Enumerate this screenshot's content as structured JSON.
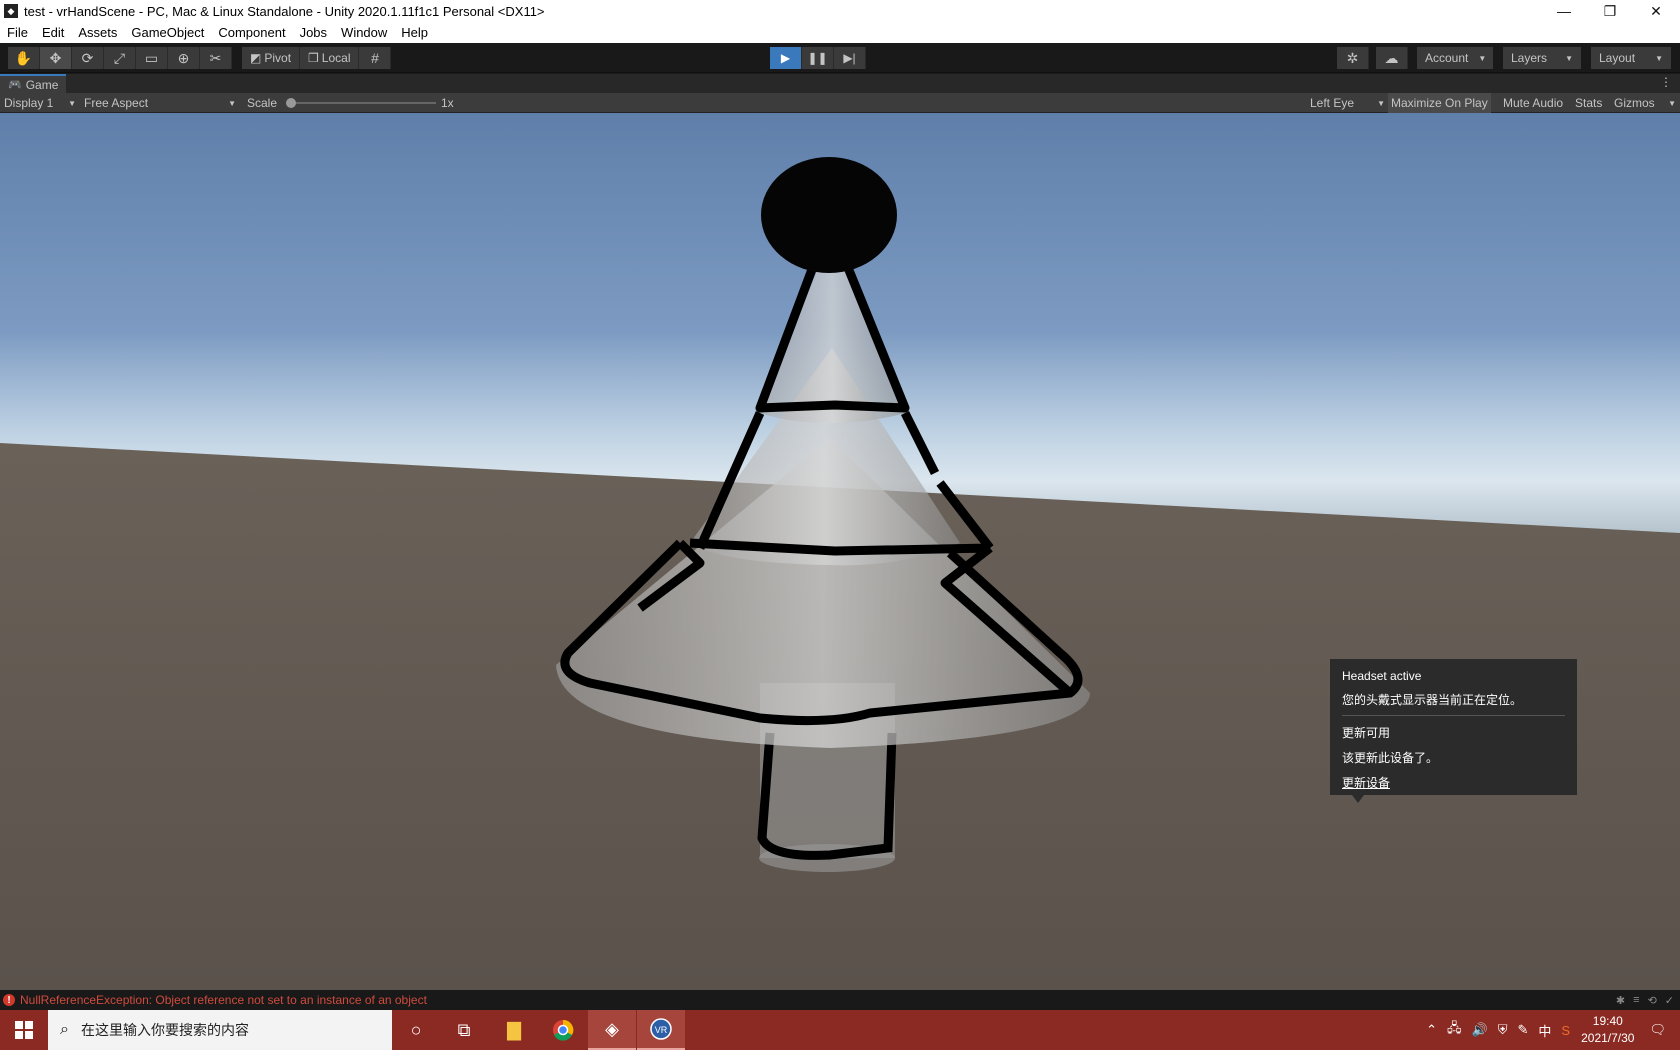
{
  "window": {
    "title": "test - vrHandScene - PC, Mac & Linux Standalone - Unity 2020.1.11f1c1 Personal <DX11>",
    "minimize": "—",
    "restore": "❐",
    "close": "✕"
  },
  "menu": [
    "File",
    "Edit",
    "Assets",
    "GameObject",
    "Component",
    "Jobs",
    "Window",
    "Help"
  ],
  "toolbar": {
    "pivot_label": "Pivot",
    "local_label": "Local",
    "account_label": "Account",
    "layers_label": "Layers",
    "layout_label": "Layout"
  },
  "game_panel": {
    "tab_label": "Game",
    "display_label": "Display 1",
    "aspect_label": "Free Aspect",
    "scale_label": "Scale",
    "scale_value": "1x",
    "eye_label": "Left Eye",
    "maximize_label": "Maximize On Play",
    "mute_label": "Mute Audio",
    "stats_label": "Stats",
    "gizmos_label": "Gizmos"
  },
  "notification": {
    "title": "Headset active",
    "subtitle": "您的头戴式显示器当前正在定位。",
    "update_title": "更新可用",
    "update_text": "该更新此设备了。",
    "update_link": "更新设备"
  },
  "status": {
    "error_message": "NullReferenceException: Object reference not set to an instance of an object"
  },
  "taskbar": {
    "search_placeholder": "在这里输入你要搜索的内容",
    "ime_label": "中",
    "time": "19:40",
    "date": "2021/7/30"
  },
  "colors": {
    "accent": "#3a79bb",
    "taskbar": "#8b2a22",
    "error": "#d04b3d"
  }
}
